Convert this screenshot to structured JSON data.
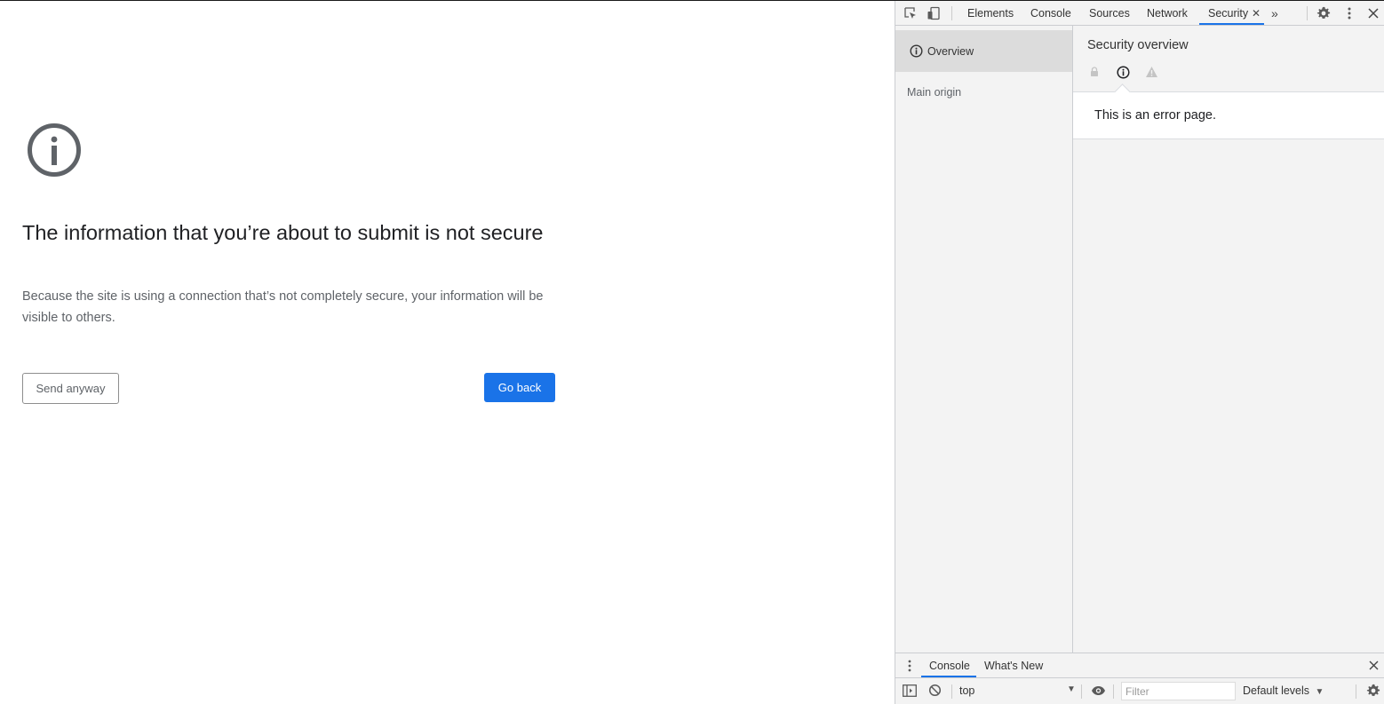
{
  "page": {
    "headline": "The information that you’re about to submit is not secure",
    "description": "Because the site is using a connection that’s not completely secure, your information will be visible to others.",
    "send_anyway_label": "Send anyway",
    "go_back_label": "Go back",
    "icon": "info-circle-icon"
  },
  "devtools": {
    "tabs": [
      "Elements",
      "Console",
      "Sources",
      "Network",
      "Security"
    ],
    "active_tab": "Security",
    "sidebar": {
      "overview_label": "Overview",
      "main_origin_label": "Main origin"
    },
    "security": {
      "title": "Security overview",
      "message": "This is an error page.",
      "state_icons": [
        "lock-icon",
        "info-icon",
        "warning-icon"
      ]
    },
    "drawer": {
      "tabs": [
        "Console",
        "What's New"
      ],
      "active_tab": "Console"
    },
    "console": {
      "context": "top",
      "filter_placeholder": "Filter",
      "levels_label": "Default levels"
    }
  },
  "colors": {
    "primary_button": "#1a73e8",
    "active_tab_underline": "#1a73e8",
    "devtools_bg": "#f3f3f3",
    "sidebar_selected": "#dcdcdc"
  }
}
